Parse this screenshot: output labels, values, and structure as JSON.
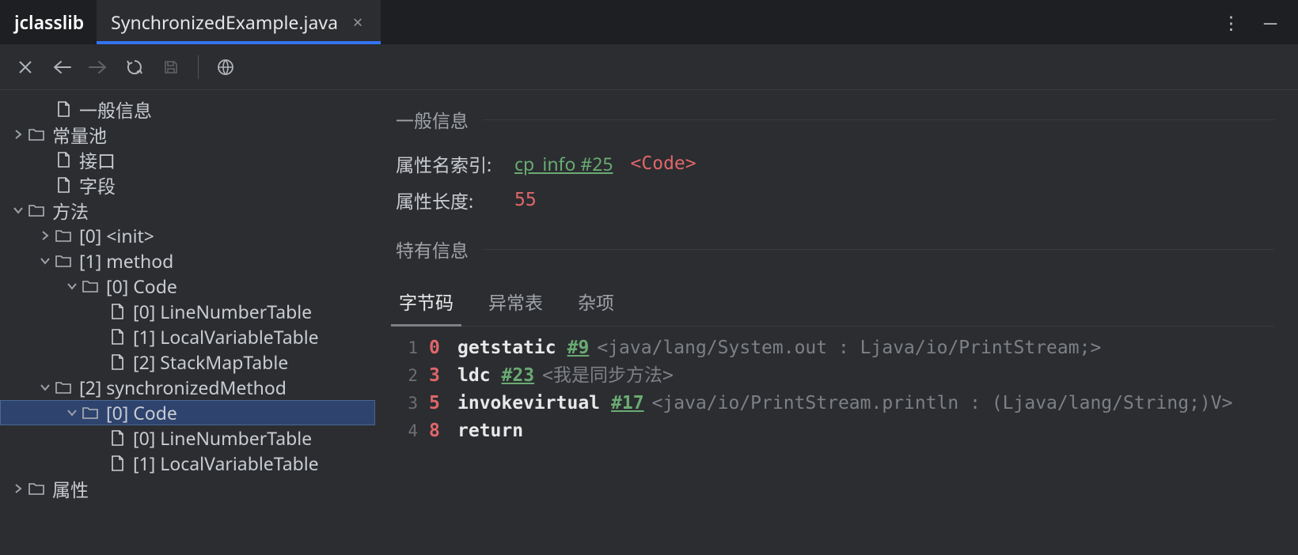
{
  "app": {
    "name": "jclasslib"
  },
  "tab": {
    "title": "SynchronizedExample.java",
    "close_glyph": "×"
  },
  "window_controls": {
    "more_glyph": "⋮",
    "minimize_glyph": "─"
  },
  "tree": [
    {
      "depth": 1,
      "caret": "none",
      "icon": "file",
      "label": "一般信息"
    },
    {
      "depth": 0,
      "caret": "right",
      "icon": "folder",
      "label": "常量池"
    },
    {
      "depth": 1,
      "caret": "none",
      "icon": "file",
      "label": "接口"
    },
    {
      "depth": 1,
      "caret": "none",
      "icon": "file",
      "label": "字段"
    },
    {
      "depth": 0,
      "caret": "down",
      "icon": "folder",
      "label": "方法"
    },
    {
      "depth": 1,
      "caret": "right",
      "icon": "folder",
      "label": "[0] <init>"
    },
    {
      "depth": 1,
      "caret": "down",
      "icon": "folder",
      "label": "[1] method"
    },
    {
      "depth": 2,
      "caret": "down",
      "icon": "folder",
      "label": "[0] Code"
    },
    {
      "depth": 3,
      "caret": "none",
      "icon": "file",
      "label": "[0] LineNumberTable"
    },
    {
      "depth": 3,
      "caret": "none",
      "icon": "file",
      "label": "[1] LocalVariableTable"
    },
    {
      "depth": 3,
      "caret": "none",
      "icon": "file",
      "label": "[2] StackMapTable"
    },
    {
      "depth": 1,
      "caret": "down",
      "icon": "folder",
      "label": "[2] synchronizedMethod"
    },
    {
      "depth": 2,
      "caret": "down",
      "icon": "folder",
      "label": "[0] Code",
      "selected": true
    },
    {
      "depth": 3,
      "caret": "none",
      "icon": "file",
      "label": "[0] LineNumberTable"
    },
    {
      "depth": 3,
      "caret": "none",
      "icon": "file",
      "label": "[1] LocalVariableTable"
    },
    {
      "depth": 0,
      "caret": "right",
      "icon": "folder",
      "label": "属性"
    }
  ],
  "detail": {
    "general_heading": "一般信息",
    "attr_name_index_label": "属性名索引:",
    "attr_name_index_link": "cp_info #25",
    "attr_name_index_tag": "<Code>",
    "attr_len_label": "属性长度:",
    "attr_len_value": "55",
    "specific_heading": "特有信息",
    "tabs": [
      {
        "label": "字节码",
        "active": true
      },
      {
        "label": "异常表",
        "active": false
      },
      {
        "label": "杂项",
        "active": false
      }
    ],
    "bytecode": [
      {
        "line": "1",
        "offset": "0",
        "opcode": "getstatic",
        "ref": "#9",
        "desc": "<java/lang/System.out : Ljava/io/PrintStream;>"
      },
      {
        "line": "2",
        "offset": "3",
        "opcode": "ldc",
        "ref": "#23",
        "desc": "<我是同步方法>"
      },
      {
        "line": "3",
        "offset": "5",
        "opcode": "invokevirtual",
        "ref": "#17",
        "desc": "<java/io/PrintStream.println : (Ljava/lang/String;)V>"
      },
      {
        "line": "4",
        "offset": "8",
        "opcode": "return",
        "ref": "",
        "desc": ""
      }
    ]
  }
}
